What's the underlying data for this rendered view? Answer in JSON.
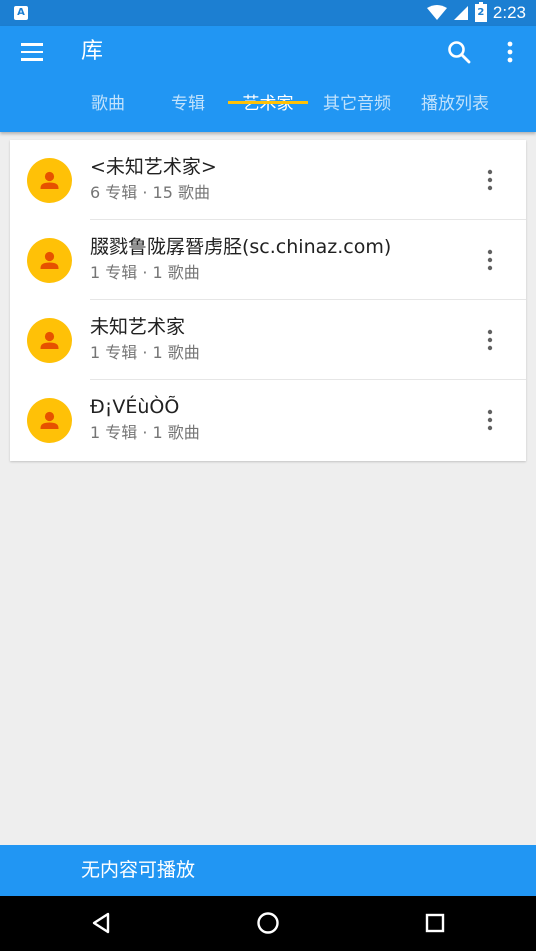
{
  "status_bar": {
    "app_icon_letter": "A",
    "battery_text": "2",
    "time": "2:23"
  },
  "app_bar": {
    "title": "库",
    "icons": {
      "menu": "menu-icon",
      "search": "search-icon",
      "overflow": "more-vert-icon"
    }
  },
  "tabs": [
    {
      "label": "歌曲",
      "active": false
    },
    {
      "label": "专辑",
      "active": false
    },
    {
      "label": "艺术家",
      "active": true
    },
    {
      "label": "其它音频",
      "active": false
    },
    {
      "label": "播放列表",
      "active": false
    }
  ],
  "artists": [
    {
      "name": "<未知艺术家>",
      "meta": "6 专辑 · 15 歌曲"
    },
    {
      "name": "腏戮鲁陇孱朁虏胫(sc.chinaz.com)",
      "meta": "1 专辑 · 1 歌曲"
    },
    {
      "name": "未知艺术家",
      "meta": "1 专辑 · 1 歌曲"
    },
    {
      "name": "Ð¡VÉùÒÕ",
      "meta": "1 专辑 · 1 歌曲"
    }
  ],
  "now_playing": {
    "text": "无内容可播放"
  },
  "colors": {
    "primary": "#2196f3",
    "status_bar": "#1c7fd2",
    "accent": "#ffc107",
    "avatar_icon": "#e65100",
    "background": "#eeeeee"
  }
}
